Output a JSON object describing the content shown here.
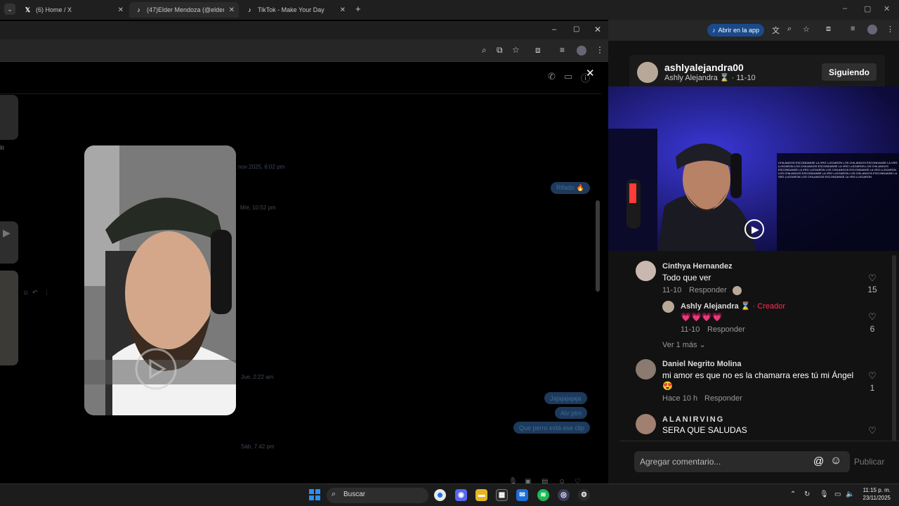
{
  "browser": {
    "tabs": [
      {
        "title": "(6) Home / X",
        "icon": "x-logo-icon"
      },
      {
        "title": "(47)Elder Mendoza (@elderme",
        "icon": "tiktok-icon"
      },
      {
        "title": "TikTok - Make Your Day",
        "icon": "tiktok-icon"
      }
    ],
    "new_tab": "+",
    "open_in_app": "Abrir en la app"
  },
  "dm": {
    "timestamps": [
      "nov 2025, 6:02 pm",
      "Mié, 10:52 pm",
      "Jue, 2:22 am",
      "Sáb, 7:42 pm"
    ],
    "left_labels": [
      "lit"
    ],
    "messages": [
      {
        "text": "Rifado 🔥"
      },
      {
        "text": "Jajajajajaja"
      },
      {
        "text": "Alv ptm"
      },
      {
        "text": "Que perro está ese clip"
      }
    ]
  },
  "tiktok": {
    "author": {
      "username": "ashlyalejandra00",
      "display": "Ashly Alejandra ⌛",
      "date": "· 11-10"
    },
    "follow_label": "Siguiendo",
    "video_overlay_text": "CHILANGOS ESCONDANSE LA VRG LLEGARON LOS CHILANGOS ESCONDANSE LA VRG LLEGARON LOS CHILANGOS ESCONDANSE LA VRG LLEGARON LOS CHILANGOS ESCONDANSE LA VRG LLEGARON LOS CHILANGOS ESCONDANSE LA VRG LLEGARON LOS CHILANGOS ESCONDANSE LA VRG LLEGARON LOS CHILANGOS ESCONDANSE LA VRG LLEGARON LOS CHILANGOS ESCONDANSE LA VRG LLEGARON",
    "comments": [
      {
        "user": "Cinthya Hernandez",
        "text": "Todo que ver",
        "time": "11-10",
        "reply": "Responder",
        "likes": "15"
      },
      {
        "user": "Ashly Alejandra ⌛",
        "tag": "· Creador",
        "text": "💗💗💗💗",
        "time": "11-10",
        "reply": "Responder",
        "likes": "6"
      },
      {
        "user": "Daniel Negrito Molina",
        "text": "mi amor es que no es la chamarra eres tú mi Ángel",
        "emoji": "😍",
        "time": "Hace 10 h",
        "reply": "Responder",
        "likes": "1"
      },
      {
        "user": "ALANIRVING",
        "text": "SERA QUE SALUDAS"
      }
    ],
    "see_more": "Ver 1 más",
    "comment_placeholder": "Agregar comentario...",
    "publish": "Publicar"
  },
  "taskbar": {
    "search": "Buscar",
    "time": "11:15 p. m.",
    "date": "23/11/2025"
  },
  "colors": {
    "accent_blue": "#1d3a5c",
    "creator_pink": "#fe2c55",
    "start_blue": "#2b8ff5"
  }
}
